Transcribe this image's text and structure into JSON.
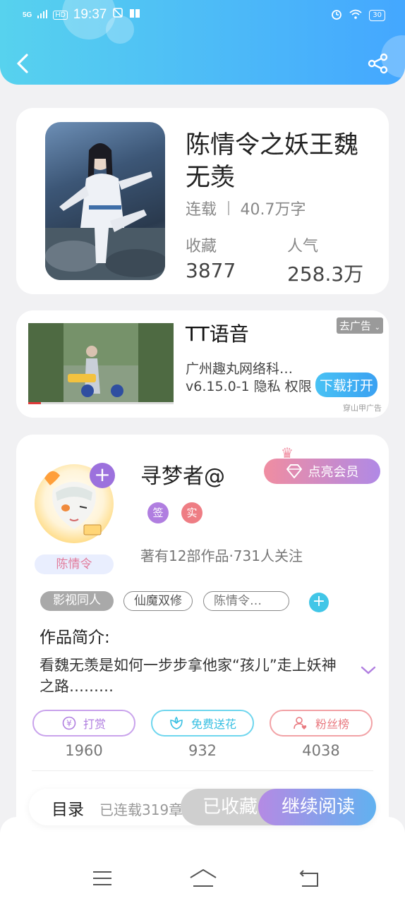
{
  "status_bar": {
    "signal": "5G",
    "hd": "HD",
    "time": "19:37",
    "battery": "30"
  },
  "book": {
    "title": "陈情令之妖王魏无羡",
    "status": "连载",
    "word_count": "40.7万字",
    "favorites_label": "收藏",
    "favorites_value": "3877",
    "popularity_label": "人气",
    "popularity_value": "258.3万"
  },
  "ad": {
    "title": "TT语音",
    "close_label": "去广告",
    "company": "广州趣丸网络科…",
    "version_line": "v6.15.0-1 隐私 权限",
    "download_label": "下载打开",
    "source": "穿山甲广告"
  },
  "author": {
    "name": "寻梦者@",
    "vip_label": "点亮会员",
    "badge_sign": "签",
    "badge_real": "实",
    "avatar_tag": "陈情令",
    "stats": "著有12部作品·731人关注",
    "tags": [
      "影视同人",
      "仙魔双修",
      "陈情令…"
    ],
    "intro_heading": "作品简介:",
    "intro_text": "看魏无羡是如何一步步拿他家“孩儿”走上妖神之路………",
    "actions": [
      {
        "label": "打赏",
        "count": "1960"
      },
      {
        "label": "免费送花",
        "count": "932"
      },
      {
        "label": "粉丝榜",
        "count": "4038"
      }
    ]
  },
  "bottom": {
    "toc_label": "目录",
    "serial_label": "已连载319章",
    "favorited_label": "已收藏",
    "read_label": "继续阅读"
  },
  "colors": {
    "header_start": "#57d2ee",
    "header_end": "#44a7ff",
    "purple": "#9c71dd",
    "cyan": "#41c6e7",
    "pink": "#ee7d84"
  },
  "icons": [
    "back-arrow-icon",
    "share-icon",
    "yen-icon",
    "flower-icon",
    "fans-icon",
    "diamond-icon",
    "crown-icon",
    "chevron-down-icon",
    "menu-icon",
    "home-icon",
    "return-icon"
  ]
}
